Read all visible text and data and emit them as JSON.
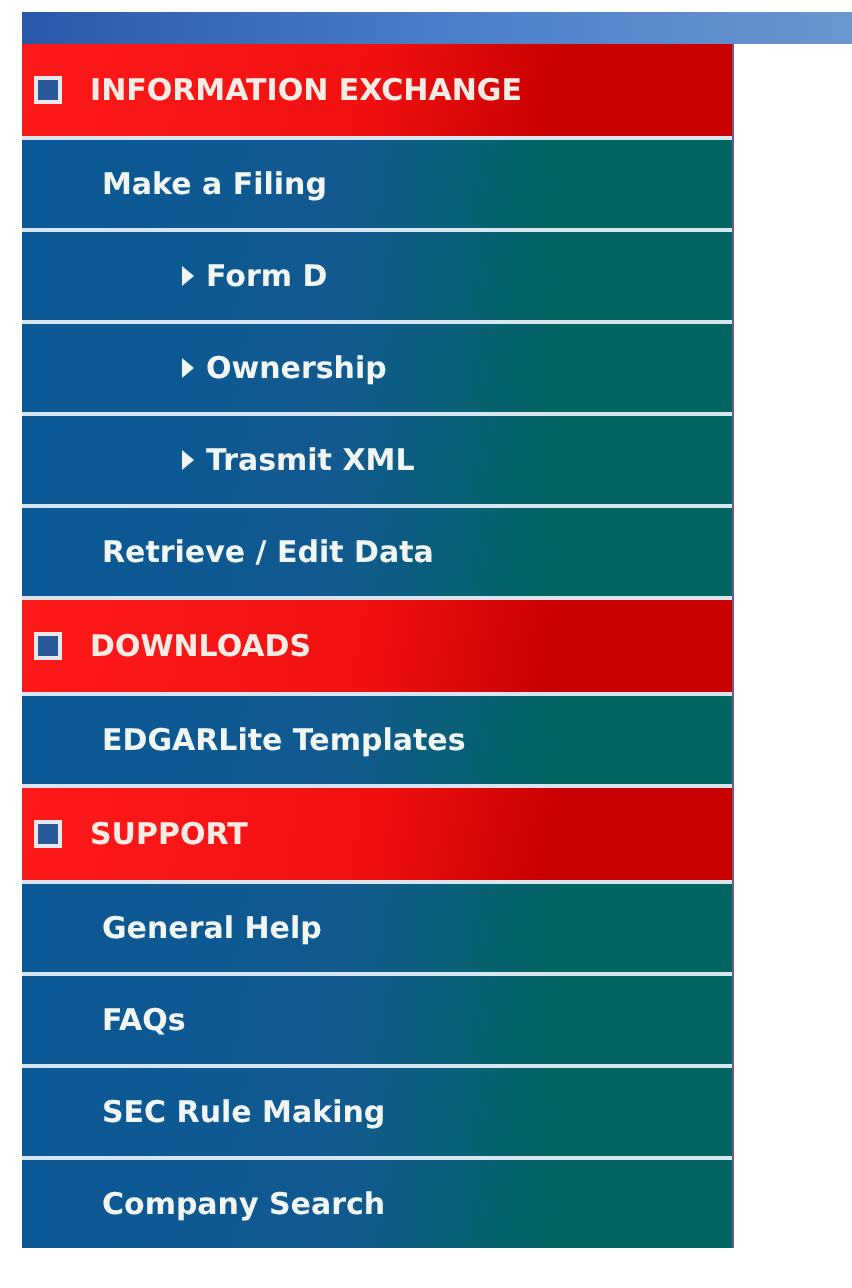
{
  "menu": {
    "sections": [
      {
        "title": "INFORMATION EXCHANGE",
        "items": [
          {
            "label": "Make a Filing",
            "children": [
              {
                "label": "Form D"
              },
              {
                "label": "Ownership"
              },
              {
                "label": "Trasmit XML"
              }
            ]
          },
          {
            "label": "Retrieve / Edit Data"
          }
        ]
      },
      {
        "title": "DOWNLOADS",
        "items": [
          {
            "label": "EDGARLite Templates"
          }
        ]
      },
      {
        "title": "SUPPORT",
        "items": [
          {
            "label": "General Help"
          },
          {
            "label": "FAQs"
          },
          {
            "label": "SEC Rule Making"
          },
          {
            "label": "Company Search"
          }
        ]
      }
    ]
  }
}
